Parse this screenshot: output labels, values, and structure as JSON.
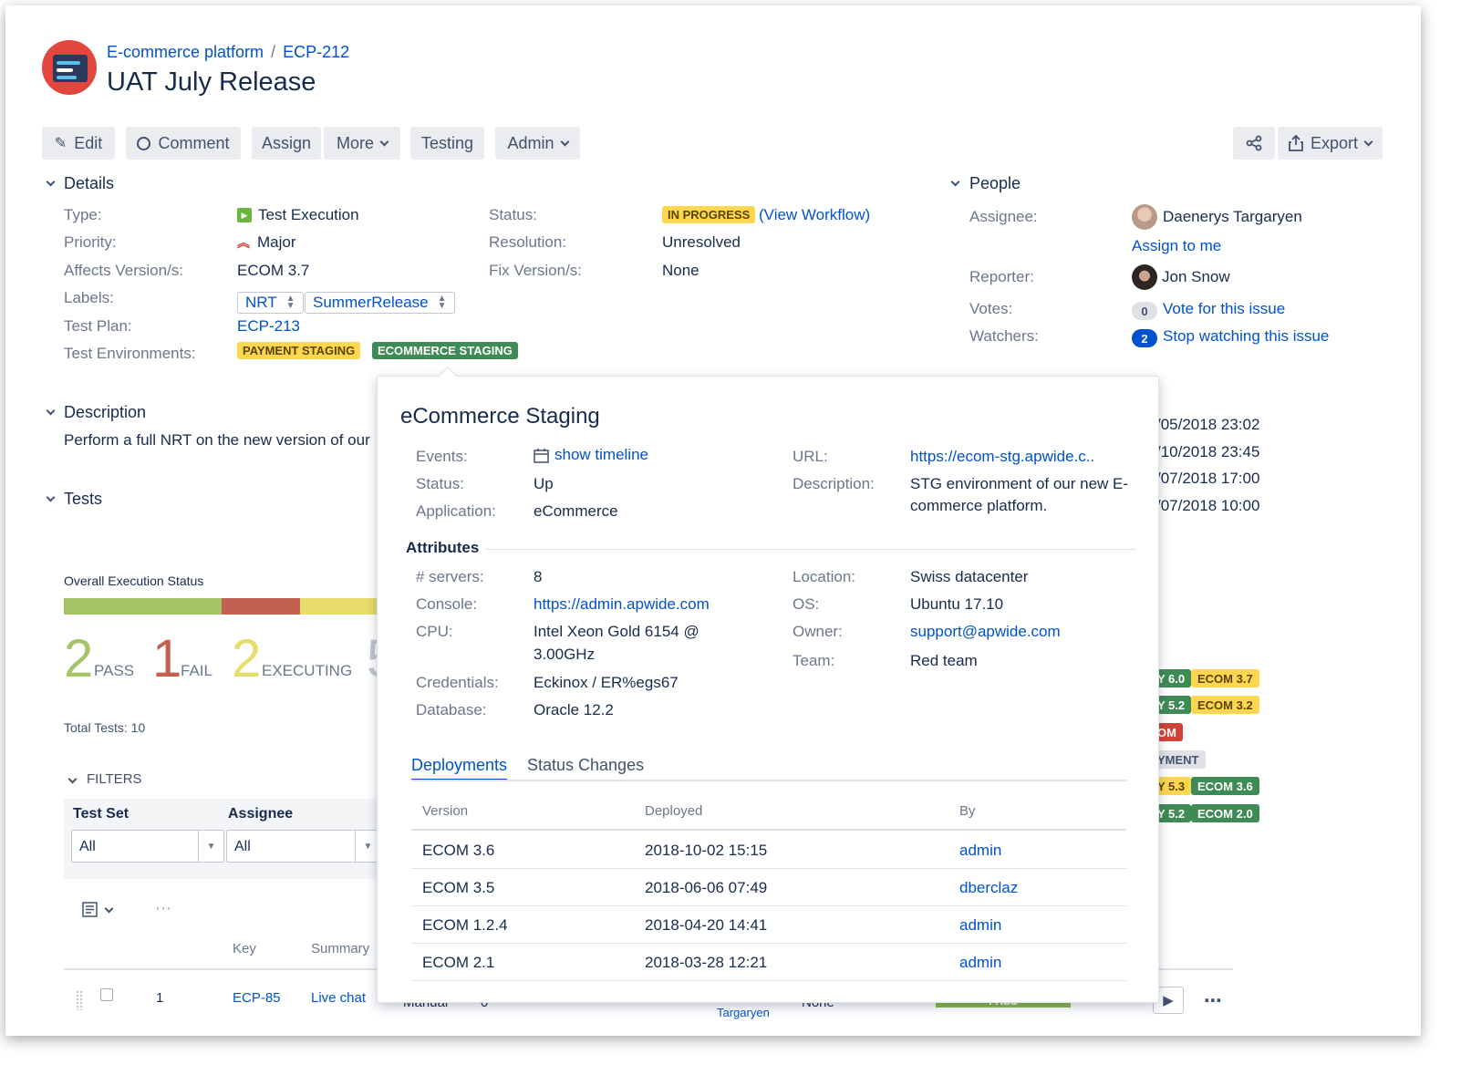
{
  "breadcrumb": {
    "project": "E-commerce platform",
    "separator": "/",
    "issue_key": "ECP-212"
  },
  "issue_title": "UAT July Release",
  "toolbar": {
    "edit": "Edit",
    "comment": "Comment",
    "assign": "Assign",
    "more": "More",
    "testing": "Testing",
    "admin": "Admin",
    "export": "Export"
  },
  "details": {
    "section_title": "Details",
    "type_label": "Type:",
    "type_value": "Test Execution",
    "priority_label": "Priority:",
    "priority_value": "Major",
    "affects_label": "Affects Version/s:",
    "affects_value": "ECOM 3.7",
    "labels_label": "Labels:",
    "labels": [
      "NRT",
      "SummerRelease"
    ],
    "test_plan_label": "Test Plan:",
    "test_plan_value": "ECP-213",
    "env_label": "Test Environments:",
    "environments": [
      "PAYMENT STAGING",
      "ECOMMERCE STAGING"
    ],
    "status_label": "Status:",
    "status_value": "IN PROGRESS",
    "view_workflow": "(View Workflow)",
    "resolution_label": "Resolution:",
    "resolution_value": "Unresolved",
    "fix_label": "Fix Version/s:",
    "fix_value": "None"
  },
  "people": {
    "section_title": "People",
    "assignee_label": "Assignee:",
    "assignee_name": "Daenerys Targaryen",
    "assign_to_me": "Assign to me",
    "reporter_label": "Reporter:",
    "reporter_name": "Jon Snow",
    "votes_label": "Votes:",
    "votes_count": "0",
    "vote_link": "Vote for this issue",
    "watchers_label": "Watchers:",
    "watchers_count": "2",
    "watch_link": "Stop watching this issue"
  },
  "dates": {
    "lines": [
      "/05/2018 23:02",
      "/10/2018 23:45",
      "/07/2018 17:00",
      "/07/2018 10:00"
    ]
  },
  "description": {
    "section_title": "Description",
    "text": "Perform a full NRT on the new version of our"
  },
  "tests": {
    "section_title": "Tests",
    "overall_label": "Overall Execution Status",
    "progress": {
      "pass_fraction": 0.5,
      "fail_fraction": 0.25
    },
    "pass_count": "2",
    "pass_word": "PASS",
    "fail_count": "1",
    "fail_word": "FAIL",
    "executing_count": "2",
    "executing_word": "EXECUTING",
    "partial_count": "5",
    "total_tests": "Total Tests: 10",
    "filters_label": "FILTERS",
    "test_set_label": "Test Set",
    "test_set_value": "All",
    "assignee_label": "Assignee",
    "assignee_value": "All",
    "columns": {
      "key": "Key",
      "summary": "Summary"
    },
    "row": {
      "index": "1",
      "key": "ECP-85",
      "summary": "Live chat",
      "type": "Manual",
      "count": "0",
      "status": "PASS",
      "resolution": "None",
      "assignee_partial": "Targaryen"
    }
  },
  "right_lozenges": [
    [
      "Y 6.0",
      "ECOM 3.7"
    ],
    [
      "Y 5.2",
      "ECOM 3.2"
    ],
    [
      "OM"
    ],
    [
      "YMENT"
    ],
    [
      "Y 5.3",
      "ECOM 3.6"
    ],
    [
      "Y 5.2",
      "ECOM 2.0"
    ]
  ],
  "popup": {
    "title": "eCommerce Staging",
    "events_label": "Events:",
    "events_link": "show timeline",
    "status_label": "Status:",
    "status_value": "Up",
    "application_label": "Application:",
    "application_value": "eCommerce",
    "url_label": "URL:",
    "url_value": "https://ecom-stg.apwide.c..",
    "description_label": "Description:",
    "description_line1": "STG environment of our new E-",
    "description_line2": "commerce platform.",
    "attributes_title": "Attributes",
    "servers_label": "# servers:",
    "servers_value": "8",
    "console_label": "Console:",
    "console_value": "https://admin.apwide.com",
    "cpu_label": "CPU:",
    "cpu_line1": "Intel Xeon Gold 6154 @",
    "cpu_line2": "3.00GHz",
    "credentials_label": "Credentials:",
    "credentials_value": "Eckinox / ER%egs67",
    "database_label": "Database:",
    "database_value": "Oracle 12.2",
    "location_label": "Location:",
    "location_value": "Swiss datacenter",
    "os_label": "OS:",
    "os_value": "Ubuntu 17.10",
    "owner_label": "Owner:",
    "owner_value": "support@apwide.com",
    "team_label": "Team:",
    "team_value": "Red team",
    "tabs": [
      "Deployments",
      "Status Changes"
    ],
    "table_headers": [
      "Version",
      "Deployed",
      "By"
    ],
    "deployments": [
      {
        "version": "ECOM 3.6",
        "deployed": "2018-10-02 15:15",
        "by": "admin"
      },
      {
        "version": "ECOM 3.5",
        "deployed": "2018-06-06 07:49",
        "by": "dberclaz"
      },
      {
        "version": "ECOM 1.2.4",
        "deployed": "2018-04-20 14:41",
        "by": "admin"
      },
      {
        "version": "ECOM 2.1",
        "deployed": "2018-03-28 12:21",
        "by": "admin"
      }
    ]
  },
  "colors": {
    "pass": "#a4c467",
    "fail": "#c46051",
    "executing": "#e8dc6d",
    "link": "#0052cc",
    "yellow_lozenge": "#ffd64f",
    "green_lozenge": "#3f8b55"
  }
}
